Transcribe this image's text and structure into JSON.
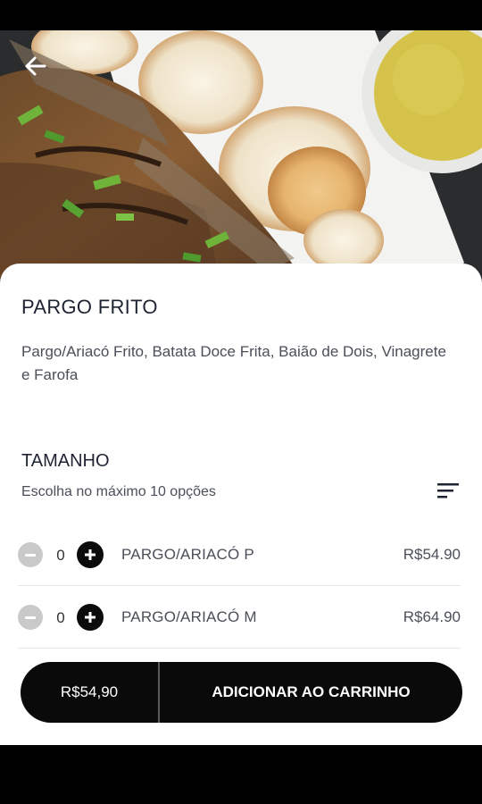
{
  "product": {
    "name": "PARGO FRITO",
    "description": "Pargo/Ariacó Frito, Batata Doce Frita, Baião de Dois, Vinagrete e Farofa"
  },
  "size_section": {
    "title": "TAMANHO",
    "subtitle": "Escolha no máximo 10 opções",
    "options": [
      {
        "name": "PARGO/ARIACÓ P",
        "price": "R$54.90",
        "qty": "0"
      },
      {
        "name": "PARGO/ARIACÓ M",
        "price": "R$64.90",
        "qty": "0"
      }
    ]
  },
  "action_bar": {
    "total": "R$54,90",
    "add_label": "ADICIONAR AO CARRINHO"
  },
  "icons": {
    "back": "arrow-left-icon",
    "sort": "sort-lines-icon",
    "plus": "plus-icon",
    "minus": "minus-icon"
  },
  "colors": {
    "primary": "#0a0a0a",
    "muted_button": "#c9c9c9",
    "text": "#1e2433",
    "secondary_text": "#4a4f58"
  }
}
